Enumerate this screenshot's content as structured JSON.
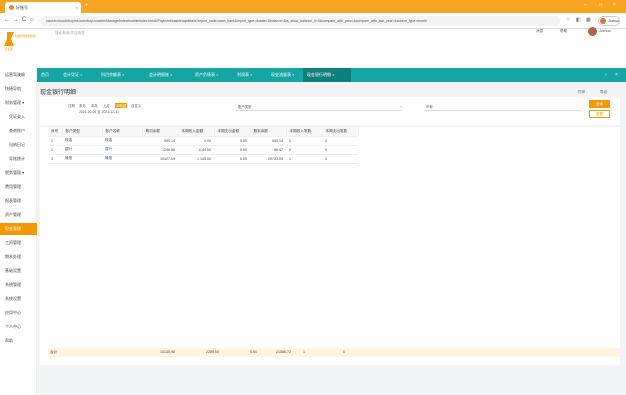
{
  "browser": {
    "tab_title": "好账号",
    "tab_close": "×",
    "new_tab": "+",
    "min": "–",
    "max": "□",
    "close": "×",
    "back": "←",
    "forward": "→",
    "reload": "C",
    "home": "⌂",
    "url": "cwuser.cloud.bhcpms.com/buy/voucher/Manage/index/mobile/index.html#/Payment/cashierapdetails?report_code=cash_bank&report_type=&state=&balance=&is_show_balance_0=0&compare_with_prev=&compare_with_last_year=&source_type=month",
    "profile_name": "Joshua"
  },
  "app": {
    "logo_text": "好账号财务软件",
    "logo_sub": "专业版",
    "search_placeholder": "搜索/账套/凭证/报表",
    "header_right": [
      "消息",
      "帮助",
      "Joshua"
    ]
  },
  "sidebar": {
    "items": [
      {
        "label": "运营驾驶舱"
      },
      {
        "label": "快捷导航"
      },
      {
        "label": "财务管理 ▾"
      },
      {
        "label": "凭证录入"
      },
      {
        "label": "查询账户"
      },
      {
        "label": "出纳日记"
      },
      {
        "label": "导账统计"
      },
      {
        "label": "税务管理 ▾"
      },
      {
        "label": "费用管理"
      },
      {
        "label": "报表管理"
      },
      {
        "label": "资产管理"
      },
      {
        "label": "现金管理"
      },
      {
        "label": "工资管理"
      },
      {
        "label": "期末处理"
      },
      {
        "label": "基础设置"
      },
      {
        "label": "系统管理"
      },
      {
        "label": "系统设置"
      },
      {
        "label": "应用中心"
      },
      {
        "label": "个人中心"
      },
      {
        "label": "帮助"
      }
    ]
  },
  "tabs": [
    {
      "label": "首页"
    },
    {
      "label": "会计凭证 ×"
    },
    {
      "label": "科目余额表 ×"
    },
    {
      "label": "会计明细账 ×"
    },
    {
      "label": "资产负债表 ×"
    },
    {
      "label": "利润表 ×"
    },
    {
      "label": "现金流量表 ×"
    },
    {
      "label": "现金银行明细 ×"
    }
  ],
  "page": {
    "title": "现金银行明细",
    "print": "打印",
    "export": "导出",
    "filter": {
      "date_label": "日期",
      "opts": [
        "本月",
        "本年",
        "上月",
        "本季度",
        "自定义"
      ],
      "selected": "本季度",
      "range": "2021-10-01 至 2021-12-31",
      "account_label": "账户类型",
      "currency_label": "币种",
      "query_btn": "查询",
      "reset_btn": "重置"
    },
    "table": {
      "headers": [
        "序号",
        "账户类型",
        "账户名称",
        "期初余额",
        "本期收入金额",
        "本期支出金额",
        "期末余额",
        "本期收入笔数",
        "本期支出笔数"
      ],
      "rows": [
        [
          "1",
          "现金",
          "现金",
          "950.14",
          "0.00",
          "0.00",
          "950.14",
          "0",
          "0"
        ],
        [
          "2",
          "银行",
          "建行",
          "-1246.56",
          "1144.00",
          "0.00",
          "-96.47",
          "0",
          "0"
        ],
        [
          "3",
          "微信",
          "微信",
          "10427.09",
          "1 145.00",
          "0.00",
          "20733.05",
          "1",
          "0"
        ]
      ],
      "total_label": "合计",
      "totals": [
        "10130.98",
        "2289.00",
        "0.00",
        "21586.72",
        "1",
        "0"
      ]
    }
  }
}
